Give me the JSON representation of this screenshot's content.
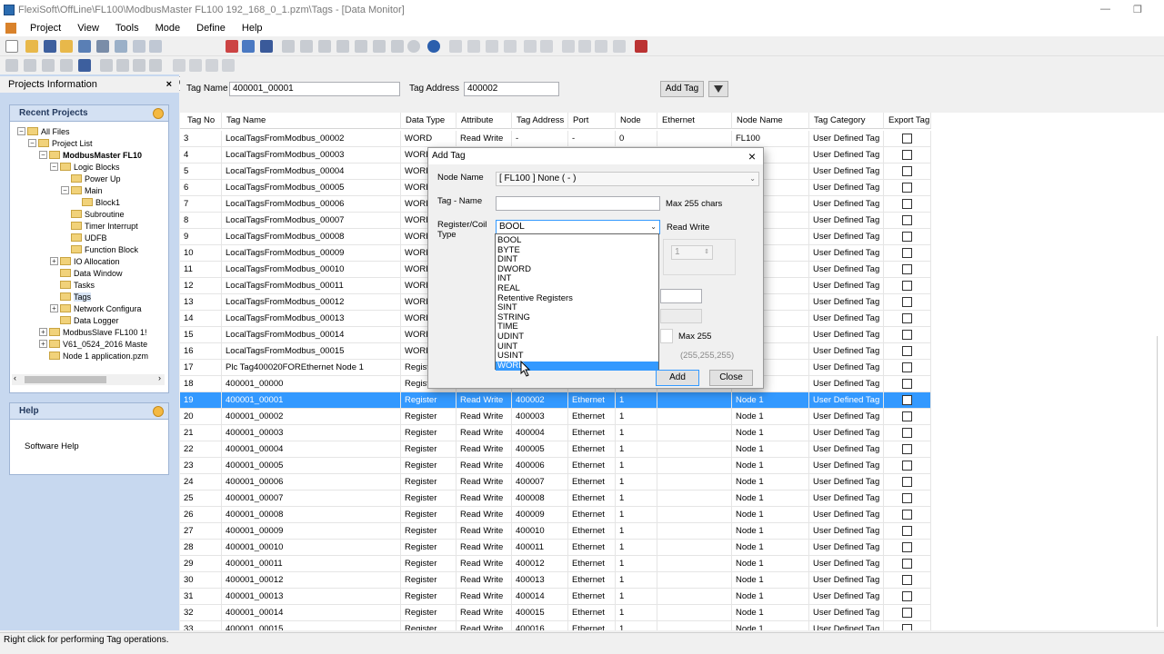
{
  "window": {
    "title": "FlexiSoft\\OffLine\\FL100\\ModbusMaster FL100 192_168_0_1.pzm\\Tags - [Data Monitor]",
    "minimize": "—",
    "restore": "❐"
  },
  "menu": [
    "Project",
    "View",
    "Tools",
    "Mode",
    "Define",
    "Help"
  ],
  "toolbar": {
    "zoom": "100"
  },
  "projects_info": {
    "title": "Projects Information",
    "close": "×"
  },
  "recent_projects": {
    "title": "Recent Projects",
    "tree": [
      {
        "label": "All Files",
        "pm": "−",
        "bold": false
      },
      {
        "label": "Project List",
        "pm": "−",
        "bold": false
      },
      {
        "label": "ModbusMaster FL10",
        "pm": "−",
        "bold": true
      },
      {
        "label": "Logic Blocks",
        "pm": "−",
        "bold": false
      },
      {
        "label": "Power Up",
        "pm": "",
        "bold": false
      },
      {
        "label": "Main",
        "pm": "−",
        "bold": false
      },
      {
        "label": "Block1",
        "pm": "",
        "bold": false
      },
      {
        "label": "Subroutine",
        "pm": "",
        "bold": false
      },
      {
        "label": "Timer Interrupt",
        "pm": "",
        "bold": false
      },
      {
        "label": "UDFB",
        "pm": "",
        "bold": false
      },
      {
        "label": "Function Block",
        "pm": "",
        "bold": false
      },
      {
        "label": "IO Allocation",
        "pm": "+",
        "bold": false
      },
      {
        "label": "Data Window",
        "pm": "",
        "bold": false
      },
      {
        "label": "Tasks",
        "pm": "",
        "bold": false
      },
      {
        "label": "Tags",
        "pm": "",
        "bold": false
      },
      {
        "label": "Network Configura",
        "pm": "+",
        "bold": false
      },
      {
        "label": "Data Logger",
        "pm": "",
        "bold": false
      },
      {
        "label": "ModbusSlave FL100 1!",
        "pm": "+",
        "bold": false
      },
      {
        "label": "V61_0524_2016 Maste",
        "pm": "+",
        "bold": false
      },
      {
        "label": "Node 1 application.pzm",
        "pm": "",
        "bold": false
      }
    ]
  },
  "help_panel": {
    "title": "Help",
    "link": "Software Help"
  },
  "tag_bar": {
    "tag_name_label": "Tag Name",
    "tag_name_value": "400001_00001",
    "tag_address_label": "Tag Address",
    "tag_address_value": "400002",
    "add_tag": "Add Tag"
  },
  "grid": {
    "columns": [
      "Tag No",
      "Tag Name",
      "Data Type",
      "Attribute",
      "Tag Address",
      "Port",
      "Node",
      "Ethernet",
      "Node Name",
      "Tag Category",
      "Export Tag"
    ],
    "rows": [
      [
        "3",
        "LocalTagsFromModbus_00002",
        "WORD",
        "Read Write",
        "-",
        "-",
        "0",
        "",
        "FL100",
        "User Defined Tag"
      ],
      [
        "4",
        "LocalTagsFromModbus_00003",
        "WORD",
        "",
        "",
        "",
        "",
        "",
        "",
        "User Defined Tag"
      ],
      [
        "5",
        "LocalTagsFromModbus_00004",
        "WORD",
        "",
        "",
        "",
        "",
        "",
        "",
        "User Defined Tag"
      ],
      [
        "6",
        "LocalTagsFromModbus_00005",
        "WORD",
        "",
        "",
        "",
        "",
        "",
        "",
        "User Defined Tag"
      ],
      [
        "7",
        "LocalTagsFromModbus_00006",
        "WORD",
        "",
        "",
        "",
        "",
        "",
        "",
        "User Defined Tag"
      ],
      [
        "8",
        "LocalTagsFromModbus_00007",
        "WORD",
        "",
        "",
        "",
        "",
        "",
        "",
        "User Defined Tag"
      ],
      [
        "9",
        "LocalTagsFromModbus_00008",
        "WORD",
        "",
        "",
        "",
        "",
        "",
        "",
        "User Defined Tag"
      ],
      [
        "10",
        "LocalTagsFromModbus_00009",
        "WORD",
        "",
        "",
        "",
        "",
        "",
        "",
        "User Defined Tag"
      ],
      [
        "11",
        "LocalTagsFromModbus_00010",
        "WORD",
        "",
        "",
        "",
        "",
        "",
        "",
        "User Defined Tag"
      ],
      [
        "12",
        "LocalTagsFromModbus_00011",
        "WORD",
        "",
        "",
        "",
        "",
        "",
        "",
        "User Defined Tag"
      ],
      [
        "13",
        "LocalTagsFromModbus_00012",
        "WORD",
        "",
        "",
        "",
        "",
        "",
        "",
        "User Defined Tag"
      ],
      [
        "14",
        "LocalTagsFromModbus_00013",
        "WORD",
        "",
        "",
        "",
        "",
        "",
        "",
        "User Defined Tag"
      ],
      [
        "15",
        "LocalTagsFromModbus_00014",
        "WORD",
        "",
        "",
        "",
        "",
        "",
        "",
        "User Defined Tag"
      ],
      [
        "16",
        "LocalTagsFromModbus_00015",
        "WORD",
        "",
        "",
        "",
        "",
        "",
        "",
        "User Defined Tag"
      ],
      [
        "17",
        "Plc Tag400020FOREthernet Node 1",
        "Registe",
        "",
        "",
        "",
        "",
        "",
        "",
        "User Defined Tag"
      ],
      [
        "18",
        "400001_00000",
        "Registe",
        "",
        "",
        "",
        "",
        "",
        "",
        "User Defined Tag"
      ],
      [
        "19",
        "400001_00001",
        "Register",
        "Read Write",
        "400002",
        "Ethernet",
        "1",
        "",
        "Node 1",
        "User Defined Tag"
      ],
      [
        "20",
        "400001_00002",
        "Register",
        "Read Write",
        "400003",
        "Ethernet",
        "1",
        "",
        "Node 1",
        "User Defined Tag"
      ],
      [
        "21",
        "400001_00003",
        "Register",
        "Read Write",
        "400004",
        "Ethernet",
        "1",
        "",
        "Node 1",
        "User Defined Tag"
      ],
      [
        "22",
        "400001_00004",
        "Register",
        "Read Write",
        "400005",
        "Ethernet",
        "1",
        "",
        "Node 1",
        "User Defined Tag"
      ],
      [
        "23",
        "400001_00005",
        "Register",
        "Read Write",
        "400006",
        "Ethernet",
        "1",
        "",
        "Node 1",
        "User Defined Tag"
      ],
      [
        "24",
        "400001_00006",
        "Register",
        "Read Write",
        "400007",
        "Ethernet",
        "1",
        "",
        "Node 1",
        "User Defined Tag"
      ],
      [
        "25",
        "400001_00007",
        "Register",
        "Read Write",
        "400008",
        "Ethernet",
        "1",
        "",
        "Node 1",
        "User Defined Tag"
      ],
      [
        "26",
        "400001_00008",
        "Register",
        "Read Write",
        "400009",
        "Ethernet",
        "1",
        "",
        "Node 1",
        "User Defined Tag"
      ],
      [
        "27",
        "400001_00009",
        "Register",
        "Read Write",
        "400010",
        "Ethernet",
        "1",
        "",
        "Node 1",
        "User Defined Tag"
      ],
      [
        "28",
        "400001_00010",
        "Register",
        "Read Write",
        "400011",
        "Ethernet",
        "1",
        "",
        "Node 1",
        "User Defined Tag"
      ],
      [
        "29",
        "400001_00011",
        "Register",
        "Read Write",
        "400012",
        "Ethernet",
        "1",
        "",
        "Node 1",
        "User Defined Tag"
      ],
      [
        "30",
        "400001_00012",
        "Register",
        "Read Write",
        "400013",
        "Ethernet",
        "1",
        "",
        "Node 1",
        "User Defined Tag"
      ],
      [
        "31",
        "400001_00013",
        "Register",
        "Read Write",
        "400014",
        "Ethernet",
        "1",
        "",
        "Node 1",
        "User Defined Tag"
      ],
      [
        "32",
        "400001_00014",
        "Register",
        "Read Write",
        "400015",
        "Ethernet",
        "1",
        "",
        "Node 1",
        "User Defined Tag"
      ],
      [
        "33",
        "400001_00015",
        "Register",
        "Read Write",
        "400016",
        "Ethernet",
        "1",
        "",
        "Node 1",
        "User Defined Tag"
      ]
    ]
  },
  "dialog": {
    "title": "Add Tag",
    "close": "×",
    "node_name_label": "Node Name",
    "node_name_value": "[ FL100 ] None ( - )",
    "tag_name_label": "Tag - Name",
    "tag_name_value": "",
    "max_chars": "Max 255 chars",
    "register_label": "Register/Coil Type",
    "register_value": "BOOL",
    "attribute": "Read Write",
    "spin_value": "1",
    "max_255": "Max 255",
    "ip_hint": "(255,255,255)",
    "add_button": "Add",
    "close_button": "Close",
    "options": [
      "BOOL",
      "BYTE",
      "DINT",
      "DWORD",
      "INT",
      "REAL",
      "Retentive Registers",
      "SINT",
      "STRING",
      "TIME",
      "UDINT",
      "UINT",
      "USINT",
      "WORD"
    ]
  },
  "status": {
    "text": "Right click for performing Tag operations."
  }
}
